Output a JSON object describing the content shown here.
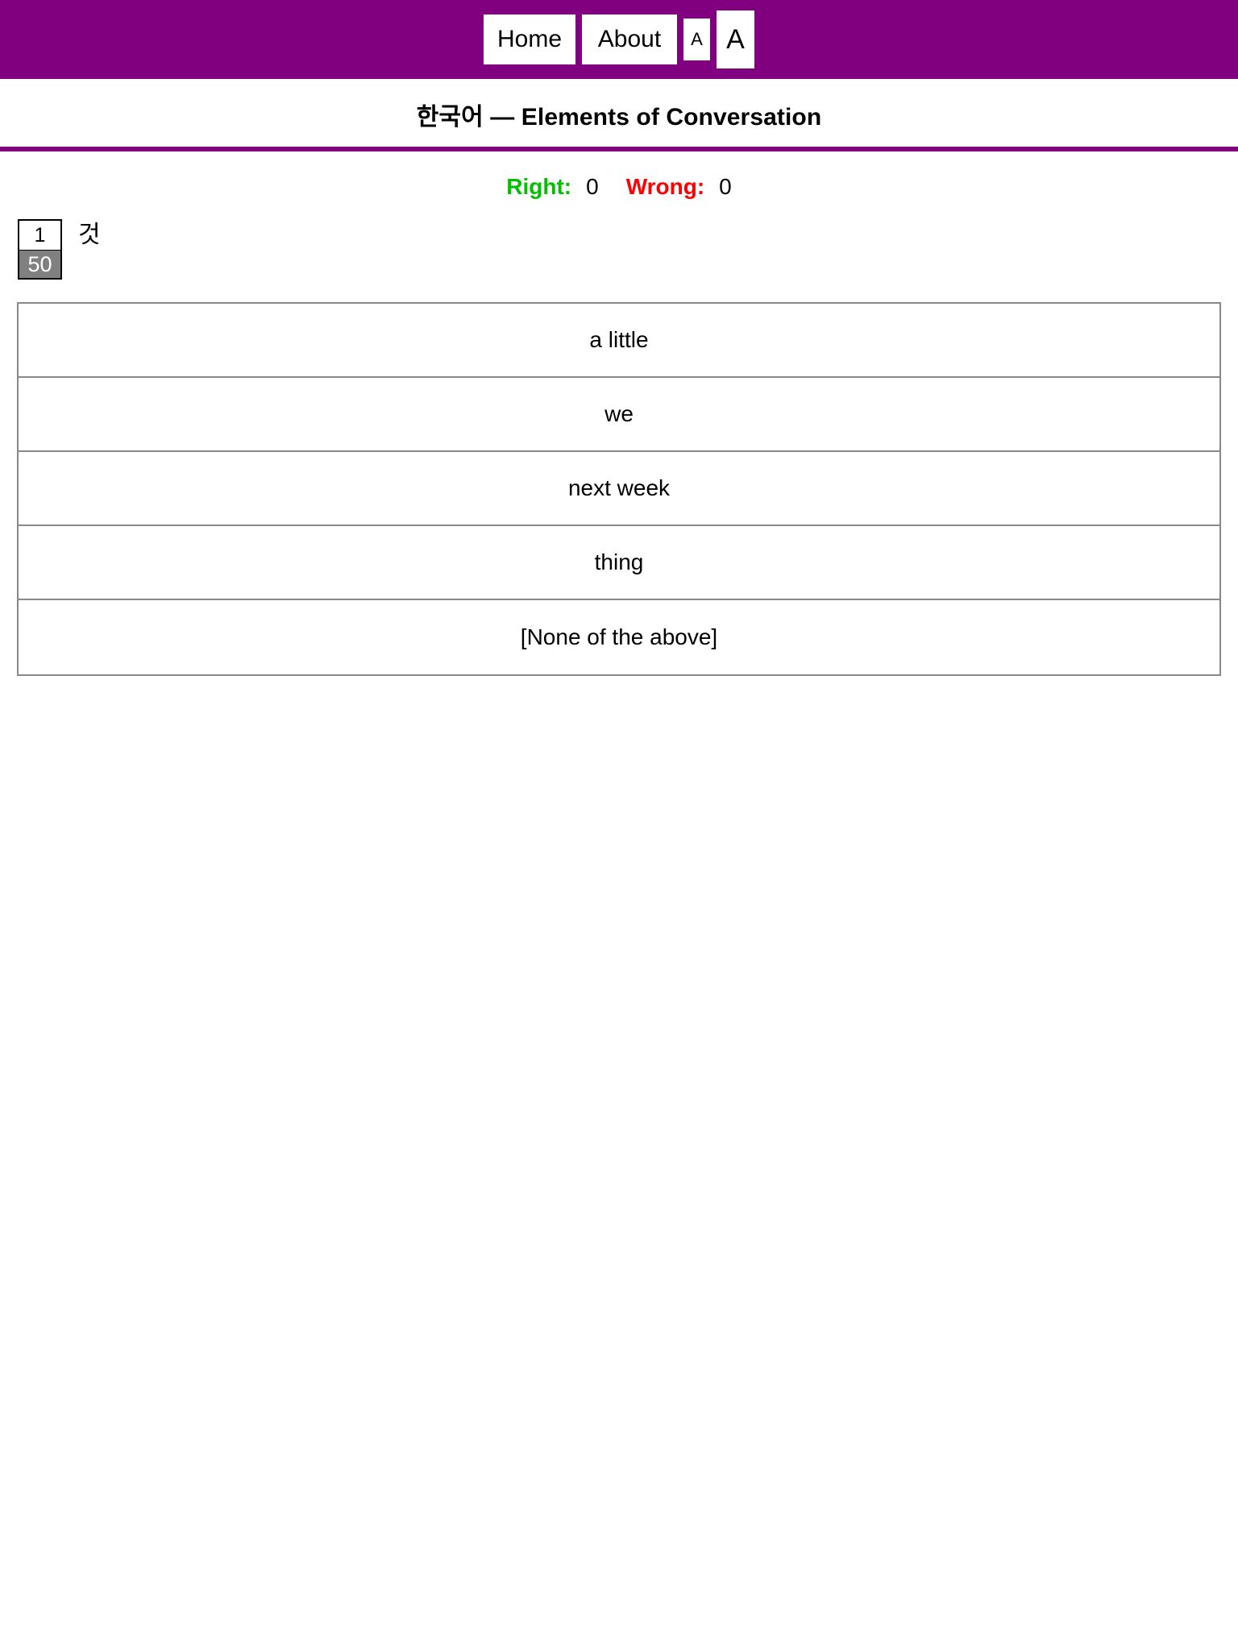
{
  "nav": {
    "items": [
      {
        "label": "Home",
        "name": "nav-home"
      },
      {
        "label": "About",
        "name": "nav-about"
      },
      {
        "label": "A",
        "name": "nav-font-decrease"
      },
      {
        "label": "A",
        "name": "nav-font-increase"
      }
    ]
  },
  "header": {
    "title": "한국어 — Elements of Conversation"
  },
  "score": {
    "right_label": "Right:",
    "right_value": "0",
    "wrong_label": "Wrong:",
    "wrong_value": "0",
    "right_color": "#00c000",
    "wrong_color": "#ff0000"
  },
  "question": {
    "current_index": "1",
    "total": "50",
    "prompt": "것"
  },
  "options": [
    {
      "label": "a little"
    },
    {
      "label": "we"
    },
    {
      "label": "next week"
    },
    {
      "label": "thing"
    },
    {
      "label": "[None of the above]"
    }
  ],
  "theme": {
    "accent": "#800080",
    "counter_bg": "#808080",
    "option_border": "#888888"
  }
}
